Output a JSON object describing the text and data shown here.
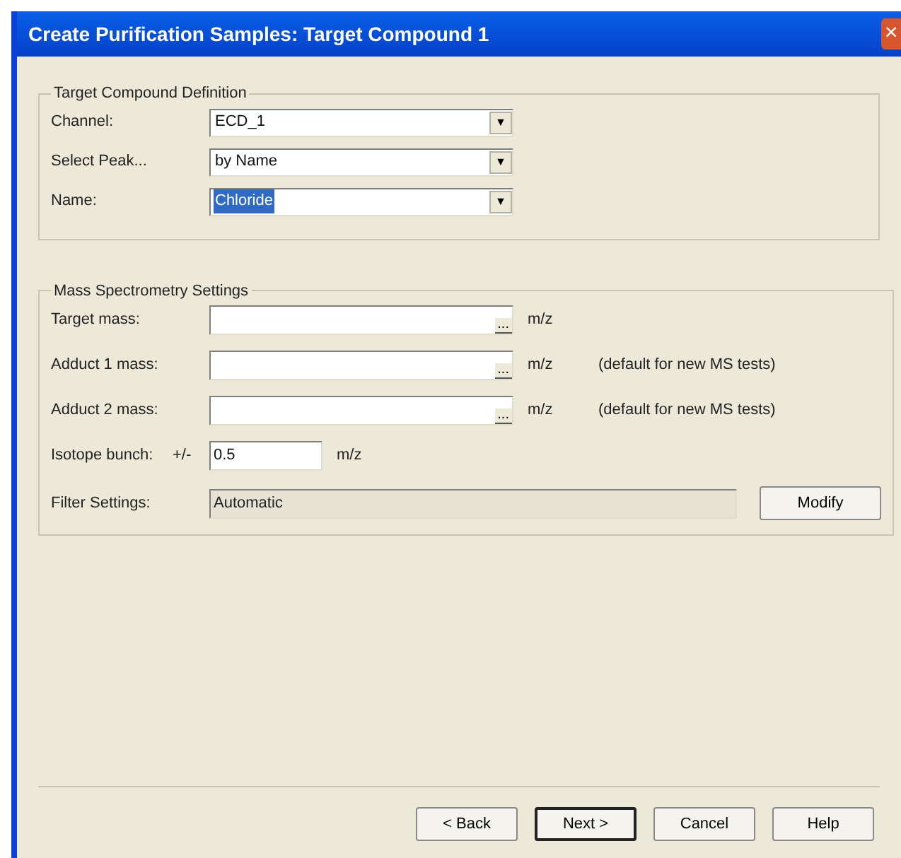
{
  "window": {
    "title": "Create Purification Samples: Target Compound 1",
    "close": "×"
  },
  "target_group": {
    "legend": "Target Compound Definition",
    "fields": [
      {
        "label": "Channel:",
        "value": "ECD_1",
        "highlighted": false,
        "arrow": "▼"
      },
      {
        "label": "Select Peak...",
        "value": "by Name",
        "highlighted": false,
        "arrow": "▼"
      },
      {
        "label": "Name:",
        "value": "Chloride",
        "highlighted": true,
        "arrow": "▼"
      }
    ]
  },
  "ms_group": {
    "legend": "Mass Spectrometry Settings",
    "mass_fields": [
      {
        "label": "Target mass:",
        "browse": "...",
        "unit": "m/z"
      },
      {
        "label": "Adduct 1 mass:",
        "browse": "...",
        "unit": "m/z",
        "note": "(default for new MS tests)"
      },
      {
        "label": "Adduct 2 mass:",
        "browse": "...",
        "unit": "m/z",
        "note": "(default for new MS tests)"
      }
    ],
    "isotope": {
      "label": "Isotope bunch:",
      "prefix": "+/-",
      "value": "0.5",
      "unit": "m/z"
    },
    "filter": {
      "label": "Filter Settings:",
      "value": "Automatic",
      "button": "Modify"
    }
  },
  "buttons": [
    {
      "label": "< Back",
      "default": false
    },
    {
      "label": "Next >",
      "default": true
    },
    {
      "label": "Cancel",
      "default": false
    },
    {
      "label": "Help",
      "default": false
    }
  ]
}
